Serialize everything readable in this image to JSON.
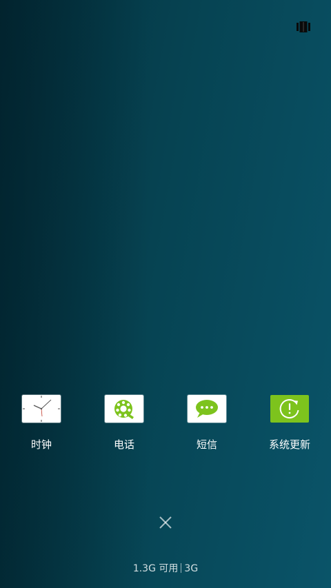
{
  "header": {
    "view_toggle_icon": "recents-grid-icon"
  },
  "recent_apps": [
    {
      "label": "时钟",
      "icon": "clock-icon"
    },
    {
      "label": "电话",
      "icon": "rotary-phone-icon"
    },
    {
      "label": "短信",
      "icon": "message-bubble-icon"
    },
    {
      "label": "系统更新",
      "icon": "system-update-icon"
    }
  ],
  "clear_all": {
    "icon": "close-icon"
  },
  "memory": {
    "available": "1.3G 可用",
    "total": "3G"
  },
  "colors": {
    "icon_green": "#7dc31d",
    "bg_dark": "#03303d",
    "bg_light": "#0a5469"
  }
}
